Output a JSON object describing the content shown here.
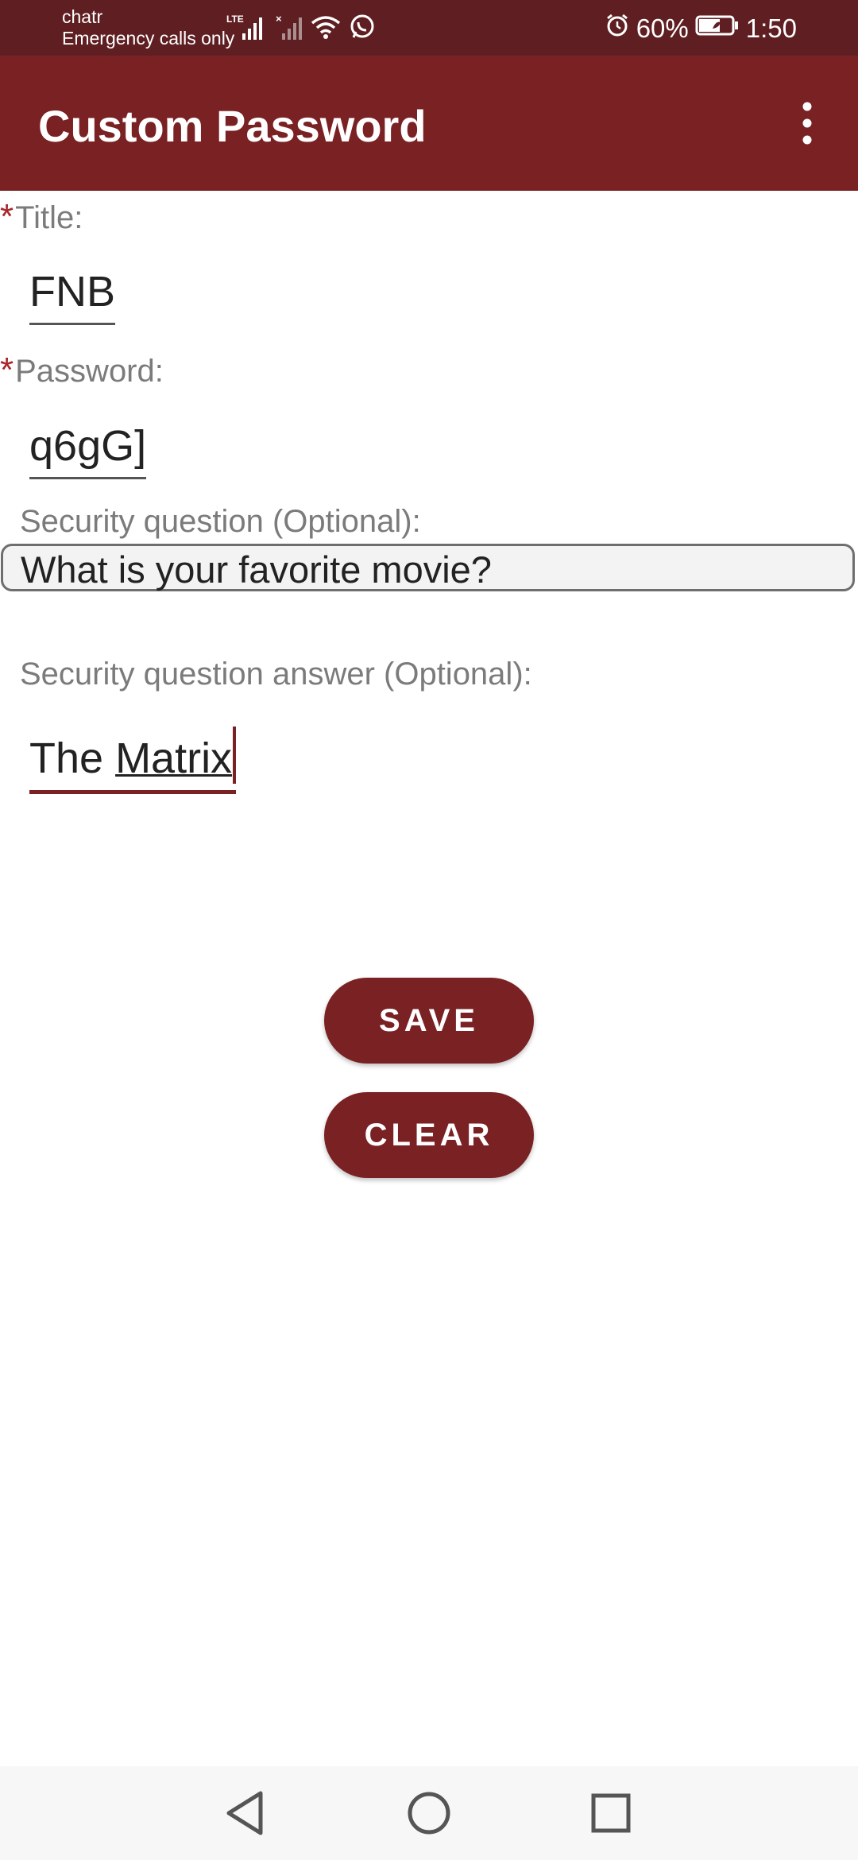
{
  "status_bar": {
    "carrier": "chatr",
    "emergency": "Emergency calls only",
    "network_badge": "LTE",
    "battery_percent": "60%",
    "time": "1:50",
    "icons": [
      "signal-icon",
      "no-signal-icon",
      "wifi-icon",
      "whatsapp-icon",
      "alarm-icon",
      "battery-icon"
    ]
  },
  "app_bar": {
    "title": "Custom Password",
    "menu_icon": "more-vert-icon"
  },
  "form": {
    "required_marker": "*",
    "title_label": "Title:",
    "title_value": "FNB",
    "password_label": "Password:",
    "password_value": "q6gG]",
    "security_question_label": "Security question (Optional):",
    "security_question_value": "What is your favorite movie?",
    "answer_label": "Security question answer (Optional):",
    "answer_value_plain": "The ",
    "answer_value_underlined": "Matrix"
  },
  "actions": {
    "save_label": "SAVE",
    "clear_label": "CLEAR"
  },
  "colors": {
    "status_bar": "#5f1f22",
    "app_bar": "#7a2123",
    "accent": "#7a2123",
    "required": "#a8262a"
  },
  "nav_bar": {
    "icons": [
      "back-icon",
      "home-icon",
      "recents-icon"
    ]
  }
}
